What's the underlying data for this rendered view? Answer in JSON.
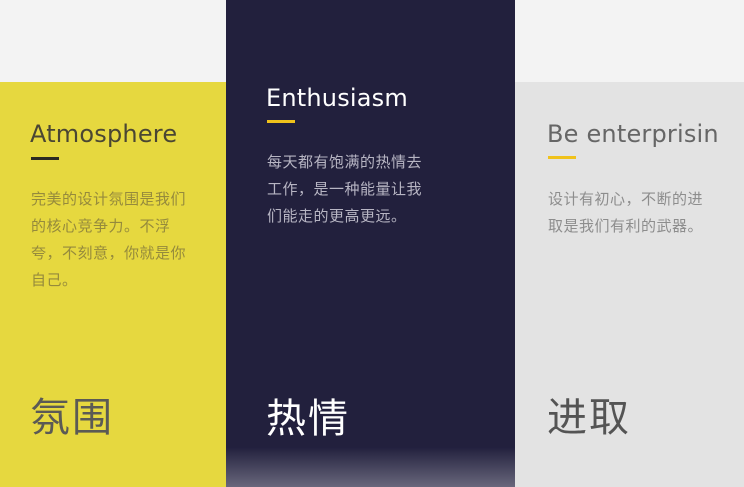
{
  "cards": [
    {
      "en_title": "Atmosphere",
      "description": "完美的设计氛围是我们的核心竞争力。不浮夸，不刻意，你就是你自己。",
      "cn_title": "氛围"
    },
    {
      "en_title": "Enthusiasm",
      "description": "每天都有饱满的热情去工作，是一种能量让我们能走的更高更远。",
      "cn_title": "热情"
    },
    {
      "en_title": "Be enterprisin",
      "description": "设计有初心，不断的进取是我们有利的武器。",
      "cn_title": "进取"
    }
  ],
  "colors": {
    "yellow": "#e6d83f",
    "navy": "#22203d",
    "gray": "#e3e3e3",
    "accent": "#f0c21b"
  }
}
